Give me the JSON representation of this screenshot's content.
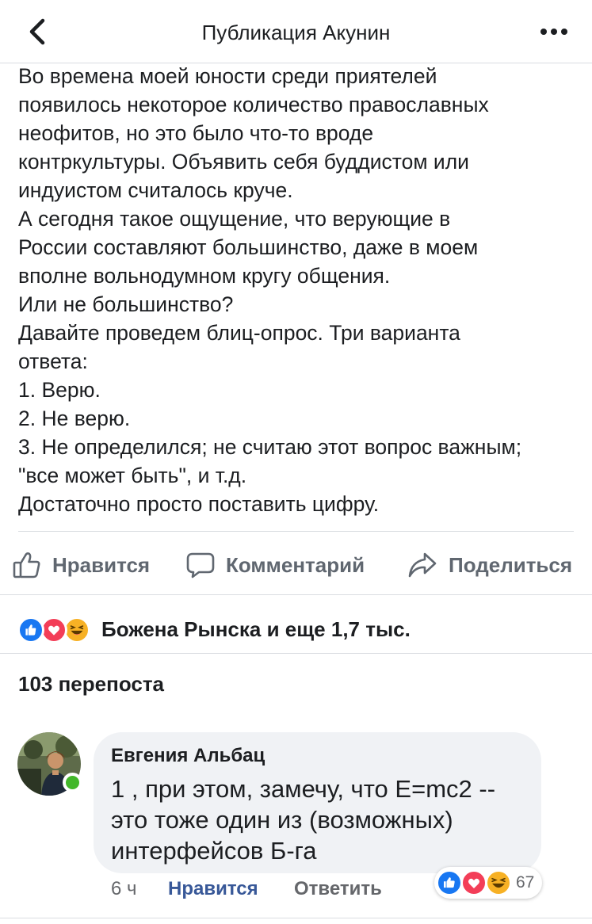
{
  "header": {
    "title": "Публикация Акунин",
    "back_icon": "chevron-left-icon",
    "more_icon": "more-horizontal-icon"
  },
  "post": {
    "lines": [
      "Во времена моей юности среди приятелей",
      "появилось некоторое количество православных",
      "неофитов, но это было что-то вроде",
      "контркультуры. Объявить себя буддистом или",
      "индуистом считалось круче.",
      "А сегодня такое ощущение, что верующие в",
      "России составляют большинство, даже в моем",
      "вполне вольнодумном кругу общения.",
      "Или не большинство?",
      "Давайте проведем блиц-опрос. Три варианта",
      "ответа:",
      "1. Верю.",
      "2. Не верю.",
      "3. Не определился; не считаю этот вопрос важным;",
      "\"все может быть\", и т.д.",
      "Достаточно просто поставить цифру."
    ]
  },
  "actions": {
    "like_label": "Нравится",
    "comment_label": "Комментарий",
    "share_label": "Поделиться"
  },
  "reactions": {
    "summary": "Божена Рынска и еще 1,7 тыс.",
    "icons": [
      "like-icon",
      "love-icon",
      "haha-icon"
    ]
  },
  "shares": {
    "label": "103 перепоста"
  },
  "comment": {
    "author": "Евгения Альбац",
    "lines": [
      "1 , при этом, замечу, что E=mc2 --",
      "это тоже один из (возможных)",
      "интерфейсов  Б-га"
    ],
    "time": "6 ч",
    "like_label": "Нравится",
    "reply_label": "Ответить",
    "reaction_count": "67",
    "online": true
  },
  "colors": {
    "like_blue": "#1877f2",
    "love_red": "#f33e58",
    "haha_yellow": "#f7b125",
    "link_blue": "#385898",
    "online_green": "#42b72a"
  }
}
